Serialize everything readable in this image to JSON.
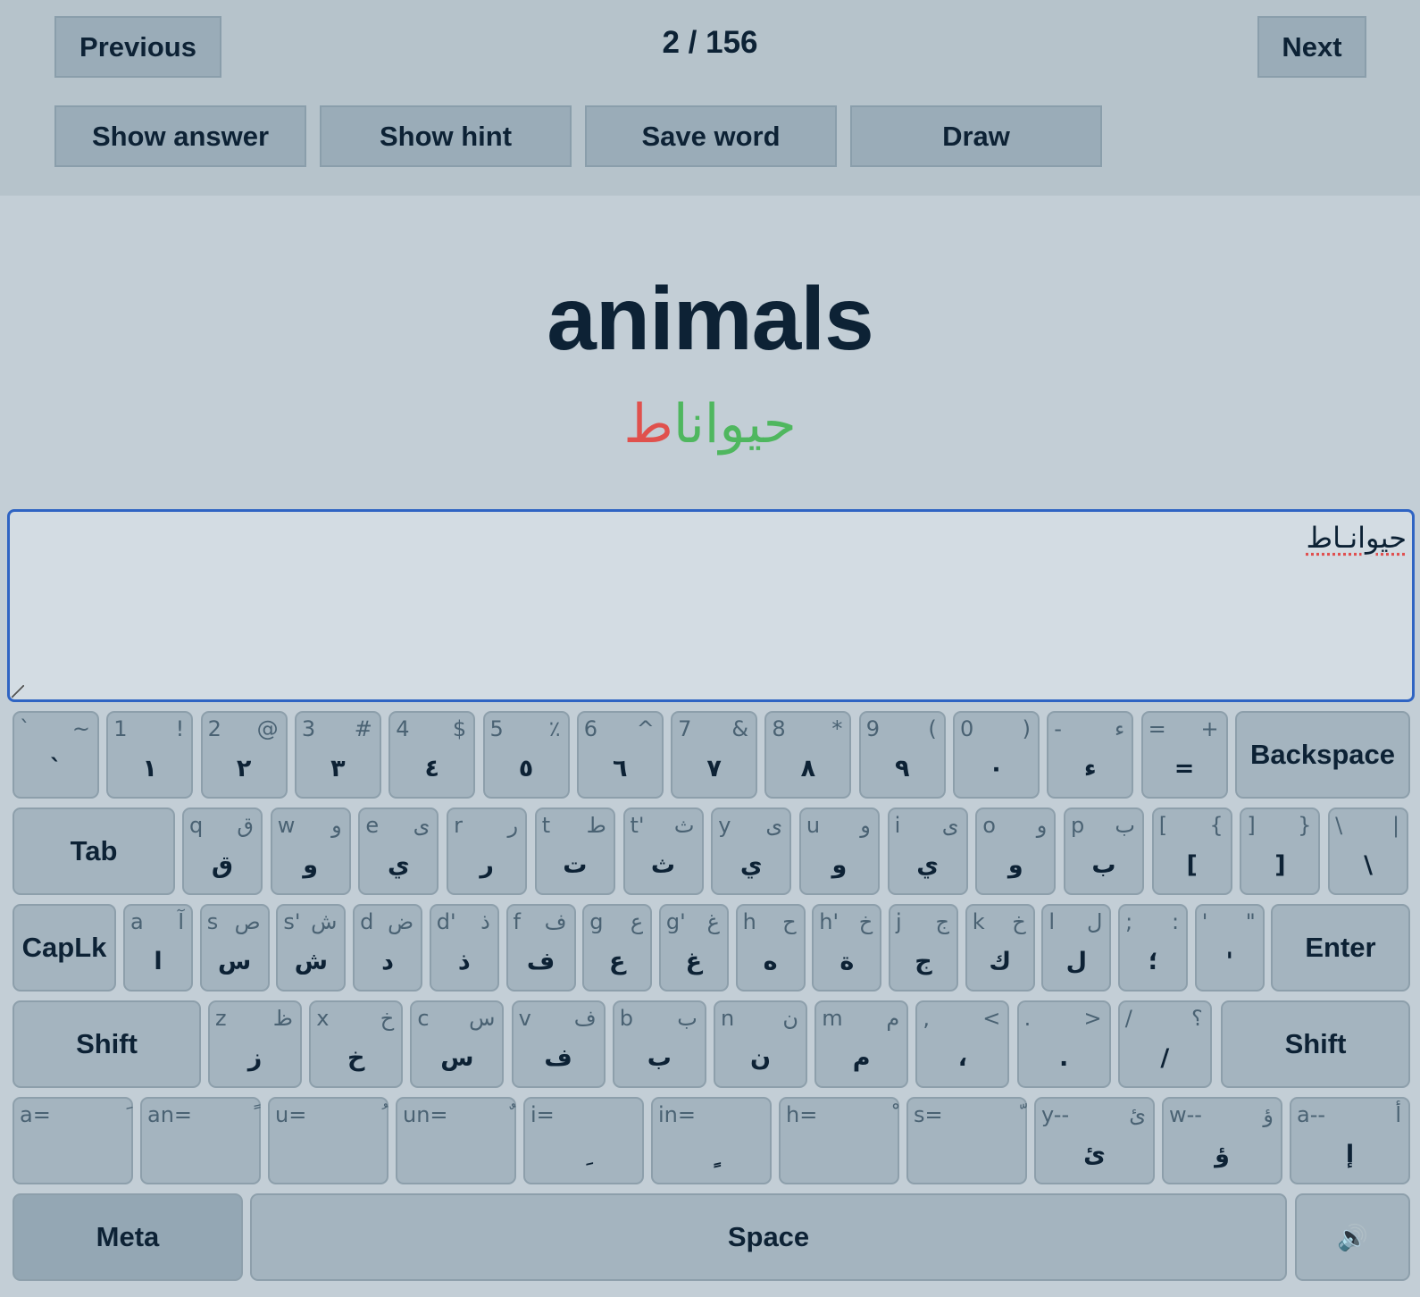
{
  "nav": {
    "previous": "Previous",
    "next": "Next",
    "counter": "2 / 156"
  },
  "actions": {
    "show_answer": "Show answer",
    "show_hint": "Show hint",
    "save_word": "Save word",
    "draw": "Draw"
  },
  "prompt": {
    "word": "animals",
    "answer_correct_part": "حيوانا",
    "answer_wrong_part": "ط"
  },
  "input": {
    "value": "حيوانـاط"
  },
  "keyboard": {
    "row1": [
      {
        "tl": "`",
        "tr": "~",
        "main": "`"
      },
      {
        "tl": "1",
        "tr": "!",
        "main": "١"
      },
      {
        "tl": "2",
        "tr": "@",
        "main": "٢"
      },
      {
        "tl": "3",
        "tr": "#",
        "main": "٣"
      },
      {
        "tl": "4",
        "tr": "$",
        "main": "٤"
      },
      {
        "tl": "5",
        "tr": "٪",
        "main": "٥"
      },
      {
        "tl": "6",
        "tr": "^",
        "main": "٦"
      },
      {
        "tl": "7",
        "tr": "&",
        "main": "٧"
      },
      {
        "tl": "8",
        "tr": "*",
        "main": "٨"
      },
      {
        "tl": "9",
        "tr": "(",
        "main": "٩"
      },
      {
        "tl": "0",
        "tr": ")",
        "main": "٠"
      },
      {
        "tl": "-",
        "tr": "ء",
        "main": "ء"
      },
      {
        "tl": "=",
        "tr": "+",
        "main": "="
      }
    ],
    "backspace": "Backspace",
    "tab": "Tab",
    "row2": [
      {
        "tl": "q",
        "tr": "ق",
        "main": "ق"
      },
      {
        "tl": "w",
        "tr": "و",
        "main": "و"
      },
      {
        "tl": "e",
        "tr": "ى",
        "main": "ي"
      },
      {
        "tl": "r",
        "tr": "ر",
        "main": "ر"
      },
      {
        "tl": "t",
        "tr": "ط",
        "main": "ت"
      },
      {
        "tl": "t'",
        "tr": "ث",
        "main": "ث"
      },
      {
        "tl": "y",
        "tr": "ى",
        "main": "ي"
      },
      {
        "tl": "u",
        "tr": "و",
        "main": "و"
      },
      {
        "tl": "i",
        "tr": "ى",
        "main": "ي"
      },
      {
        "tl": "o",
        "tr": "و",
        "main": "و"
      },
      {
        "tl": "p",
        "tr": "ب",
        "main": "ب"
      },
      {
        "tl": "[",
        "tr": "{",
        "main": "["
      },
      {
        "tl": "]",
        "tr": "}",
        "main": "]"
      },
      {
        "tl": "\\",
        "tr": "|",
        "main": "\\"
      }
    ],
    "caplk": "CapLk",
    "row3": [
      {
        "tl": "a",
        "tr": "آ",
        "main": "ا"
      },
      {
        "tl": "s",
        "tr": "ص",
        "main": "س"
      },
      {
        "tl": "s'",
        "tr": "ش",
        "main": "ش"
      },
      {
        "tl": "d",
        "tr": "ض",
        "main": "د"
      },
      {
        "tl": "d'",
        "tr": "ذ",
        "main": "ذ"
      },
      {
        "tl": "f",
        "tr": "ف",
        "main": "ف"
      },
      {
        "tl": "g",
        "tr": "ع",
        "main": "ع"
      },
      {
        "tl": "g'",
        "tr": "غ",
        "main": "غ"
      },
      {
        "tl": "h",
        "tr": "ح",
        "main": "ه"
      },
      {
        "tl": "h'",
        "tr": "خ",
        "main": "ة"
      },
      {
        "tl": "j",
        "tr": "ج",
        "main": "ج"
      },
      {
        "tl": "k",
        "tr": "خ",
        "main": "ك"
      },
      {
        "tl": "l",
        "tr": "ل",
        "main": "ل"
      },
      {
        "tl": ";",
        "tr": ":",
        "main": "؛"
      },
      {
        "tl": "'",
        "tr": "\"",
        "main": "'"
      }
    ],
    "enter": "Enter",
    "shift": "Shift",
    "row4": [
      {
        "tl": "z",
        "tr": "ظ",
        "main": "ز"
      },
      {
        "tl": "x",
        "tr": "خ",
        "main": "خ"
      },
      {
        "tl": "c",
        "tr": "س",
        "main": "س"
      },
      {
        "tl": "v",
        "tr": "ف",
        "main": "ف"
      },
      {
        "tl": "b",
        "tr": "ب",
        "main": "ب"
      },
      {
        "tl": "n",
        "tr": "ن",
        "main": "ن"
      },
      {
        "tl": "m",
        "tr": "م",
        "main": "م"
      },
      {
        "tl": ",",
        "tr": "<",
        "main": "،"
      },
      {
        "tl": ".",
        "tr": ">",
        "main": "."
      },
      {
        "tl": "/",
        "tr": "؟",
        "main": "/"
      }
    ],
    "row5": [
      {
        "tl": "a=",
        "tr": "َ",
        "main": ""
      },
      {
        "tl": "an=",
        "tr": "ً",
        "main": ""
      },
      {
        "tl": "u=",
        "tr": "ُ",
        "main": ""
      },
      {
        "tl": "un=",
        "tr": "ٌ",
        "main": ""
      },
      {
        "tl": "i=",
        "tr": "",
        "main": "ِ"
      },
      {
        "tl": "in=",
        "tr": "",
        "main": "ٍ"
      },
      {
        "tl": "h=",
        "tr": "ْ",
        "main": ""
      },
      {
        "tl": "s=",
        "tr": "ّ",
        "main": ""
      },
      {
        "tl": "y--",
        "tr": "ئ",
        "main": "ئ"
      },
      {
        "tl": "w--",
        "tr": "ؤ",
        "main": "ؤ"
      },
      {
        "tl": "a--",
        "tr": "أ",
        "main": "إ"
      }
    ],
    "meta": "Meta",
    "space": "Space",
    "speaker_icon": "🔊"
  }
}
